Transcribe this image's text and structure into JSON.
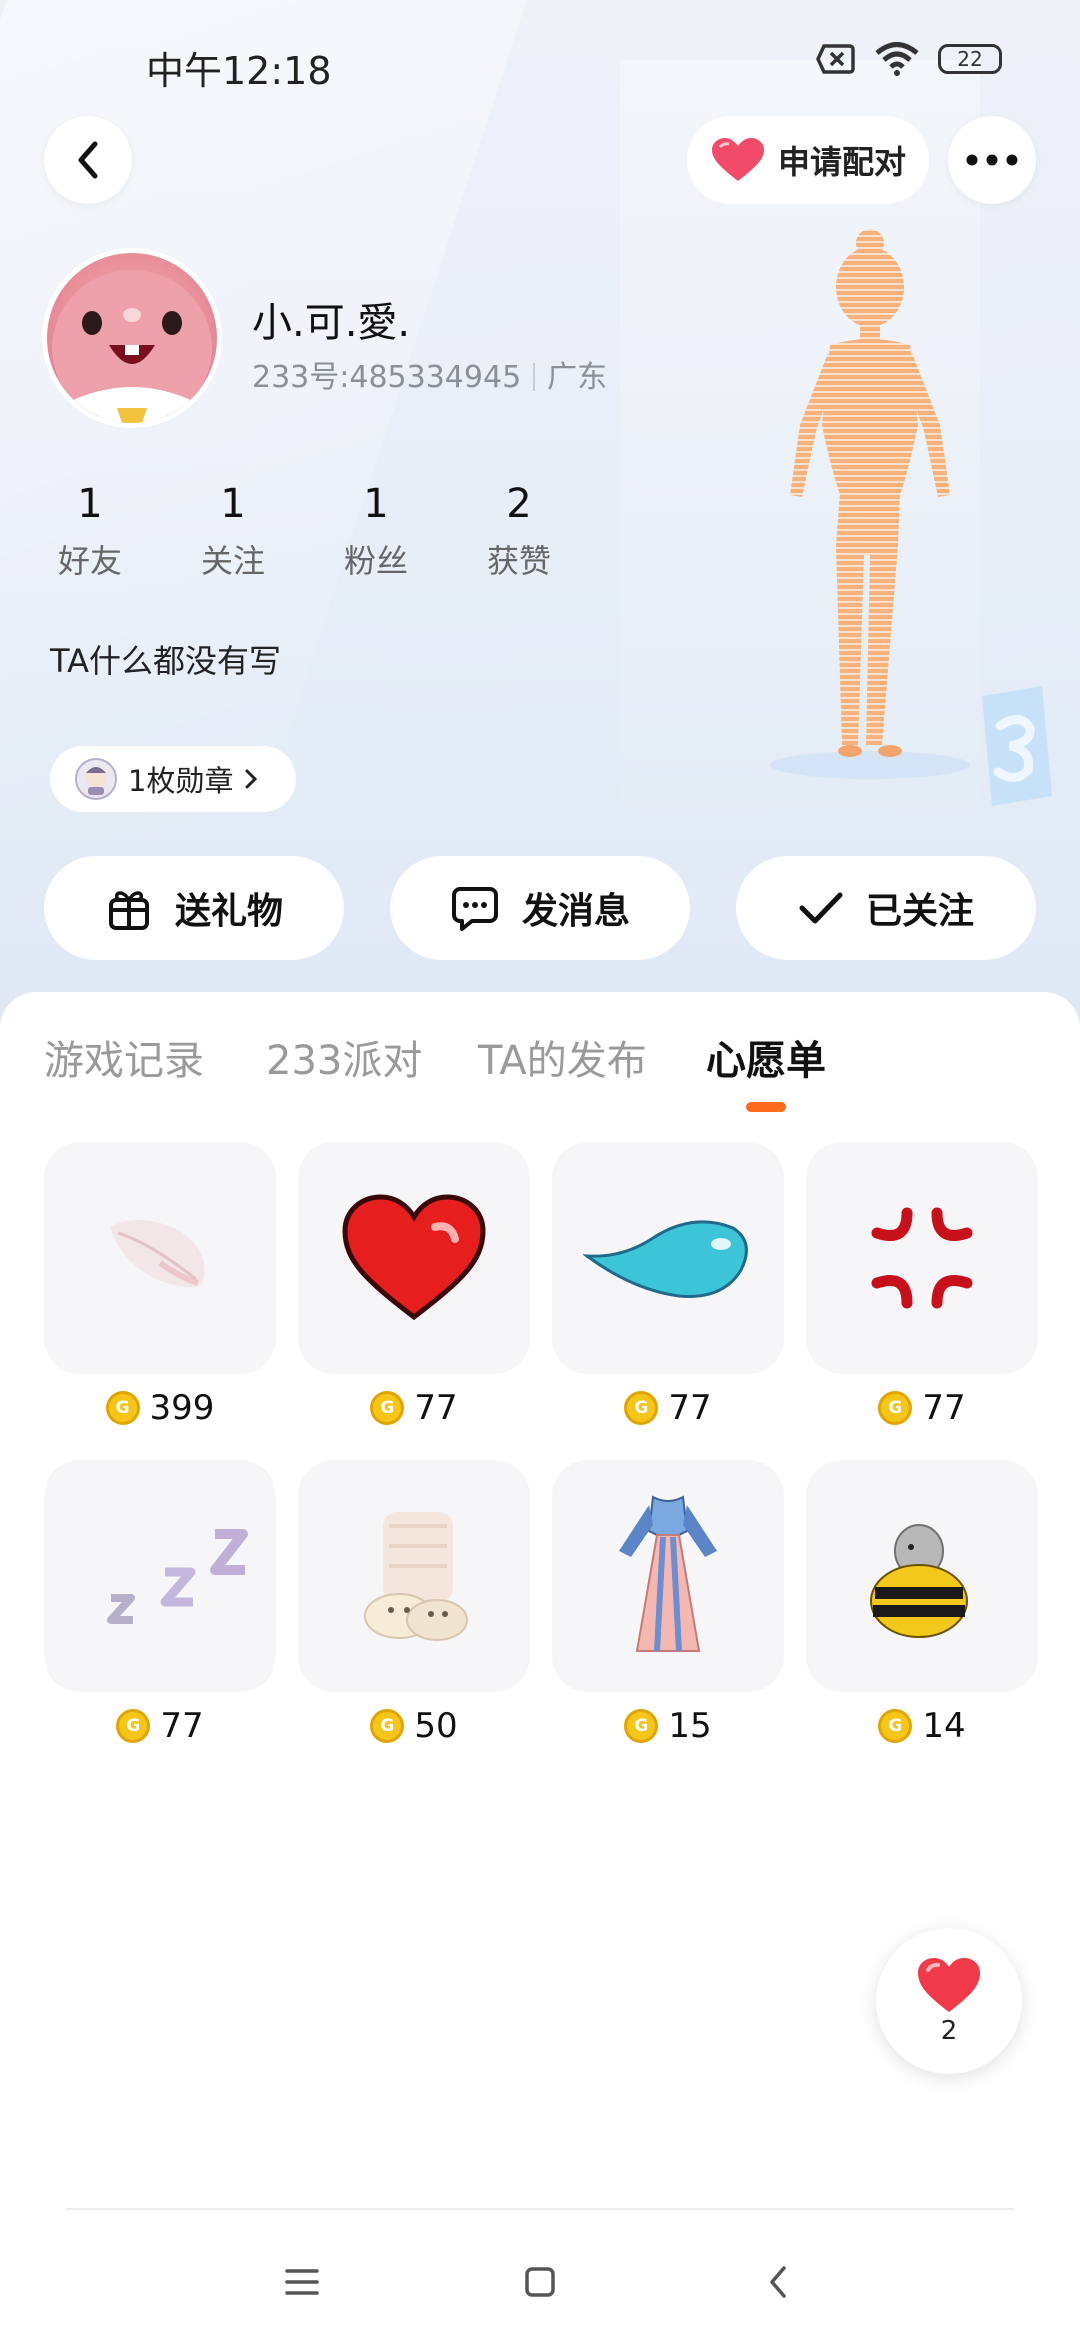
{
  "status_bar": {
    "time": "中午12:18",
    "battery": "22"
  },
  "header": {
    "pair_label": "申请配对"
  },
  "profile": {
    "nickname": "小.可.愛.",
    "uid": "233号:485334945",
    "location": "广东",
    "bio": "TA什么都没有写",
    "medal_label": "1枚勋章"
  },
  "stats": [
    {
      "num": "1",
      "label": "好友"
    },
    {
      "num": "1",
      "label": "关注"
    },
    {
      "num": "1",
      "label": "粉丝"
    },
    {
      "num": "2",
      "label": "获赞"
    }
  ],
  "actions": {
    "gift_label": "送礼物",
    "message_label": "发消息",
    "follow_label": "已关注"
  },
  "tabs": [
    {
      "label": "游戏记录",
      "active": false
    },
    {
      "label": "233派对",
      "active": false
    },
    {
      "label": "TA的发布",
      "active": false
    },
    {
      "label": "心愿单",
      "active": true
    }
  ],
  "wishlist": [
    {
      "icon": "feather-icon",
      "price": "399"
    },
    {
      "icon": "heart-icon",
      "price": "77"
    },
    {
      "icon": "droplet-icon",
      "price": "77"
    },
    {
      "icon": "anger-icon",
      "price": "77"
    },
    {
      "icon": "zzz-icon",
      "price": "77"
    },
    {
      "icon": "bunny-slippers-icon",
      "price": "50"
    },
    {
      "icon": "hanfu-dress-icon",
      "price": "15"
    },
    {
      "icon": "bee-costume-icon",
      "price": "14"
    }
  ],
  "like_fab": {
    "count": "2"
  },
  "colors": {
    "accent": "#ff6b1a",
    "coin": "#f5c518",
    "heart": "#f03a4a"
  }
}
